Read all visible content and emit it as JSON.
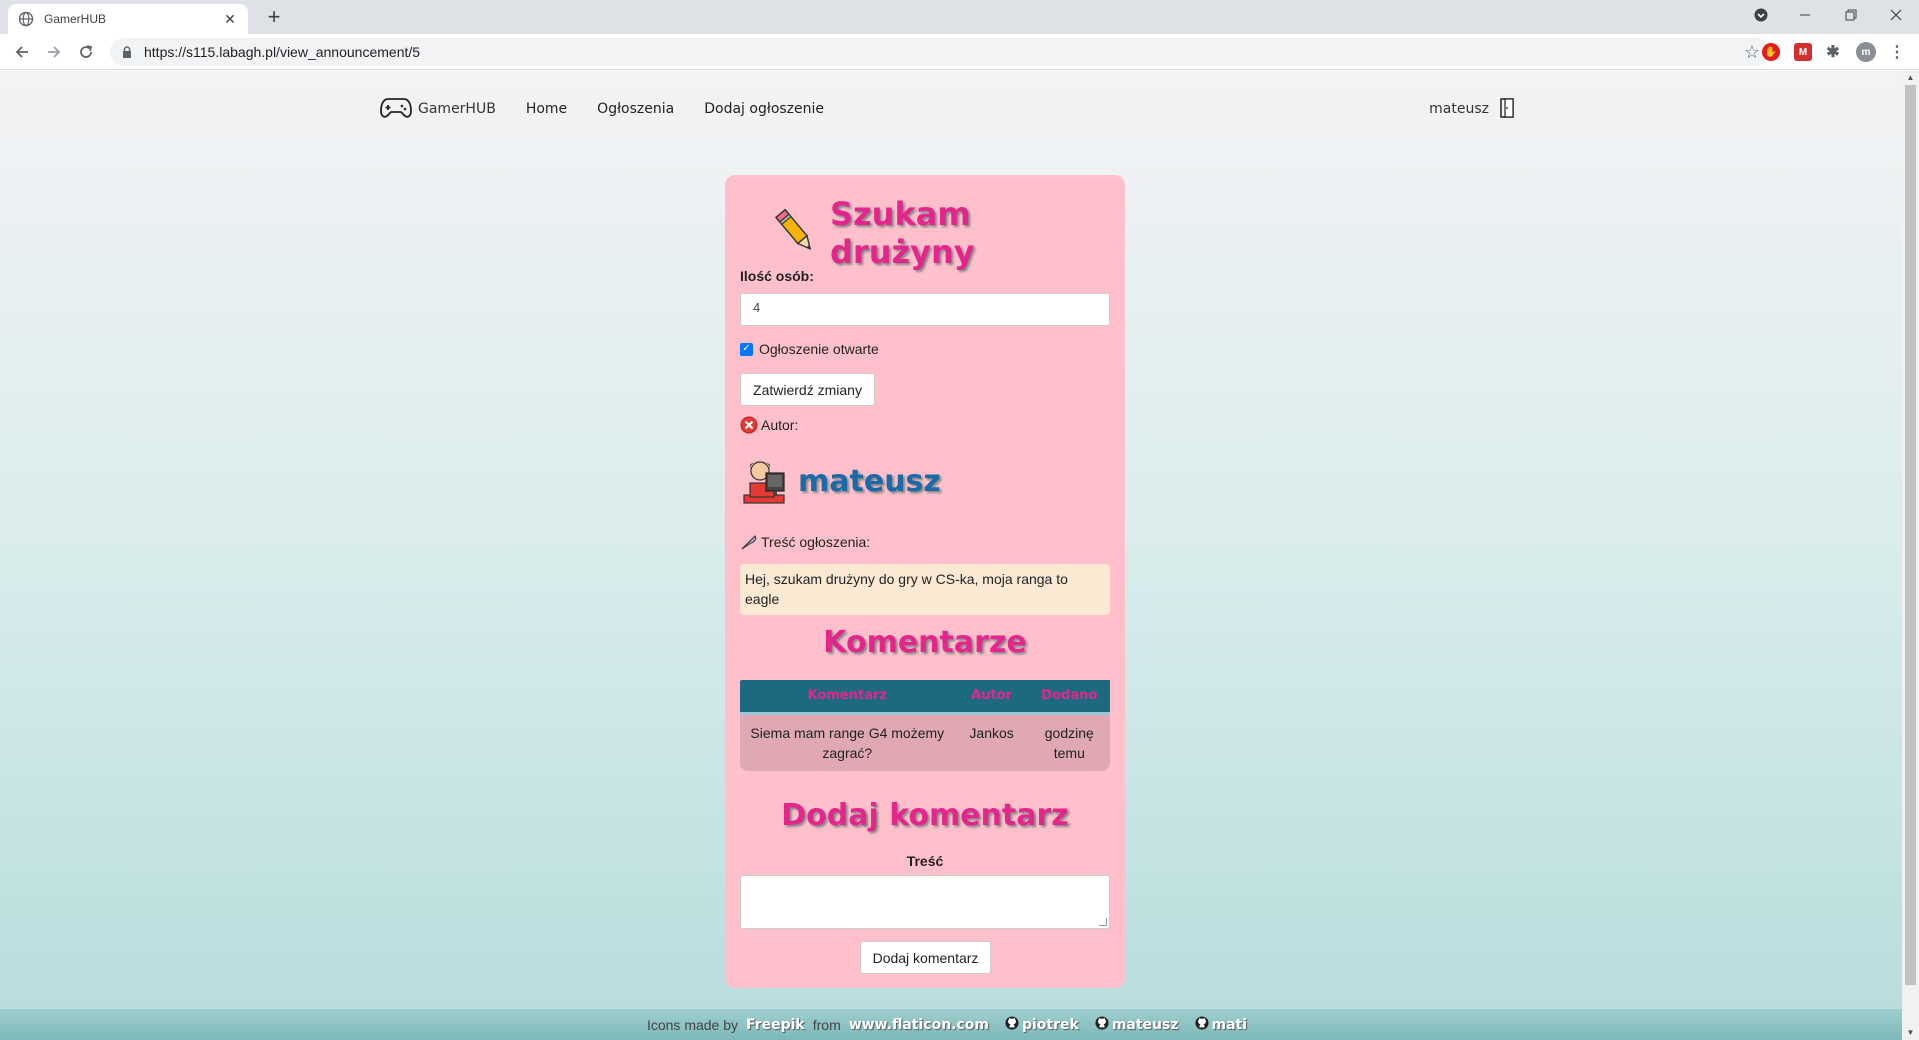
{
  "browser": {
    "tab_title": "GamerHUB",
    "new_tab_symbol": "+",
    "url": "https://s115.labagh.pl/view_announcement/5",
    "profile_initial": "m"
  },
  "nav": {
    "brand": "GamerHUB",
    "links": [
      "Home",
      "Ogłoszenia",
      "Dodaj ogłoszenie"
    ],
    "username": "mateusz"
  },
  "announcement": {
    "title": "Szukam drużyny",
    "people_label": "Ilość osób:",
    "people_value": "4",
    "open_label": "Ogłoszenie otwarte",
    "open_checked": true,
    "save_button": "Zatwierdź zmiany",
    "author_label": "Autor:",
    "author_name": "mateusz",
    "content_label": "Treść ogłoszenia:",
    "content": "Hej, szukam drużyny do gry w CS-ka, moja ranga to eagle"
  },
  "comments": {
    "title": "Komentarze",
    "headers": [
      "Komentarz",
      "Autor",
      "Dodano"
    ],
    "rows": [
      {
        "comment": "Siema mam range G4 możemy zagrać?",
        "author": "Jankos",
        "added": "godzinę temu"
      }
    ]
  },
  "add_comment": {
    "title": "Dodaj komentarz",
    "label": "Treść",
    "button": "Dodaj komentarz"
  },
  "footer": {
    "made_by": "Icons made by",
    "freepik": "Freepik",
    "from": "from",
    "site": "www.flaticon.com",
    "authors": [
      "piotrek",
      "mateusz",
      "mati"
    ]
  },
  "colors": {
    "card_bg": "#ffc0cb",
    "accent_pink": "#e4268c",
    "author_blue": "#1a6aa8",
    "table_header": "#1c6a80"
  }
}
